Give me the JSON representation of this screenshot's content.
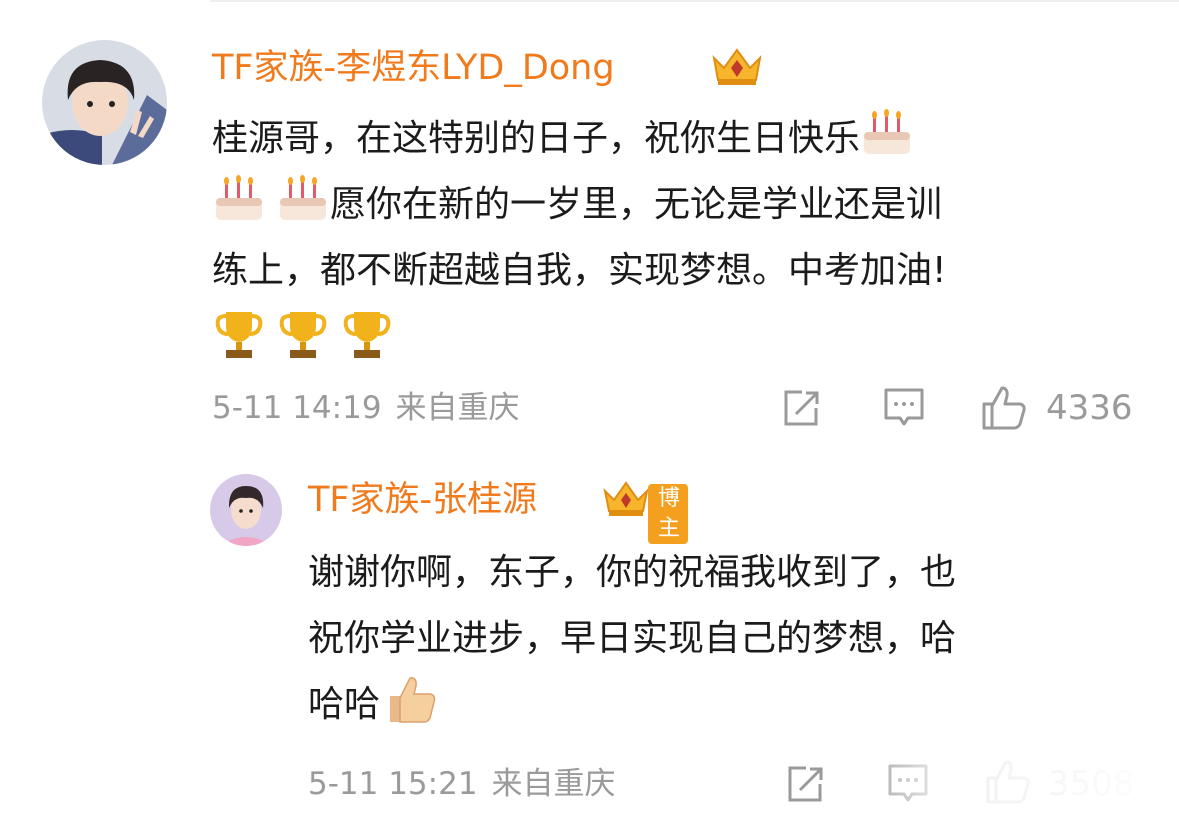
{
  "comment1": {
    "username": "TF家族-李煜东LYD_Dong",
    "lines": [
      "桂源哥，在这特别的日子，祝你生日快乐",
      "愿你在新的一岁里，无论是学业还是训",
      "练上，都不断超越自我，实现梦想。中考加油!"
    ],
    "emojis": [
      "cake-emoji",
      "trophy-emoji"
    ],
    "timestamp": "5-11 14:19",
    "location": "来自重庆",
    "like_count": "4336"
  },
  "reply1": {
    "username": "TF家族-张桂源",
    "badge": "博主",
    "lines": [
      "谢谢你啊，东子，你的祝福我收到了，也",
      "祝你学业进步，早日实现自己的梦想，哈",
      "哈哈"
    ],
    "emojis": [
      "thumbs-up-emoji"
    ],
    "timestamp": "5-11 15:21",
    "location": "来自重庆",
    "like_count": "3508"
  },
  "icons": [
    "share-icon",
    "comment-icon",
    "like-icon",
    "crown-icon"
  ],
  "colors": {
    "username": "#f07a1c",
    "meta": "#9a9a9a",
    "badge": "#f4a01e",
    "text": "#1b1b1b"
  }
}
